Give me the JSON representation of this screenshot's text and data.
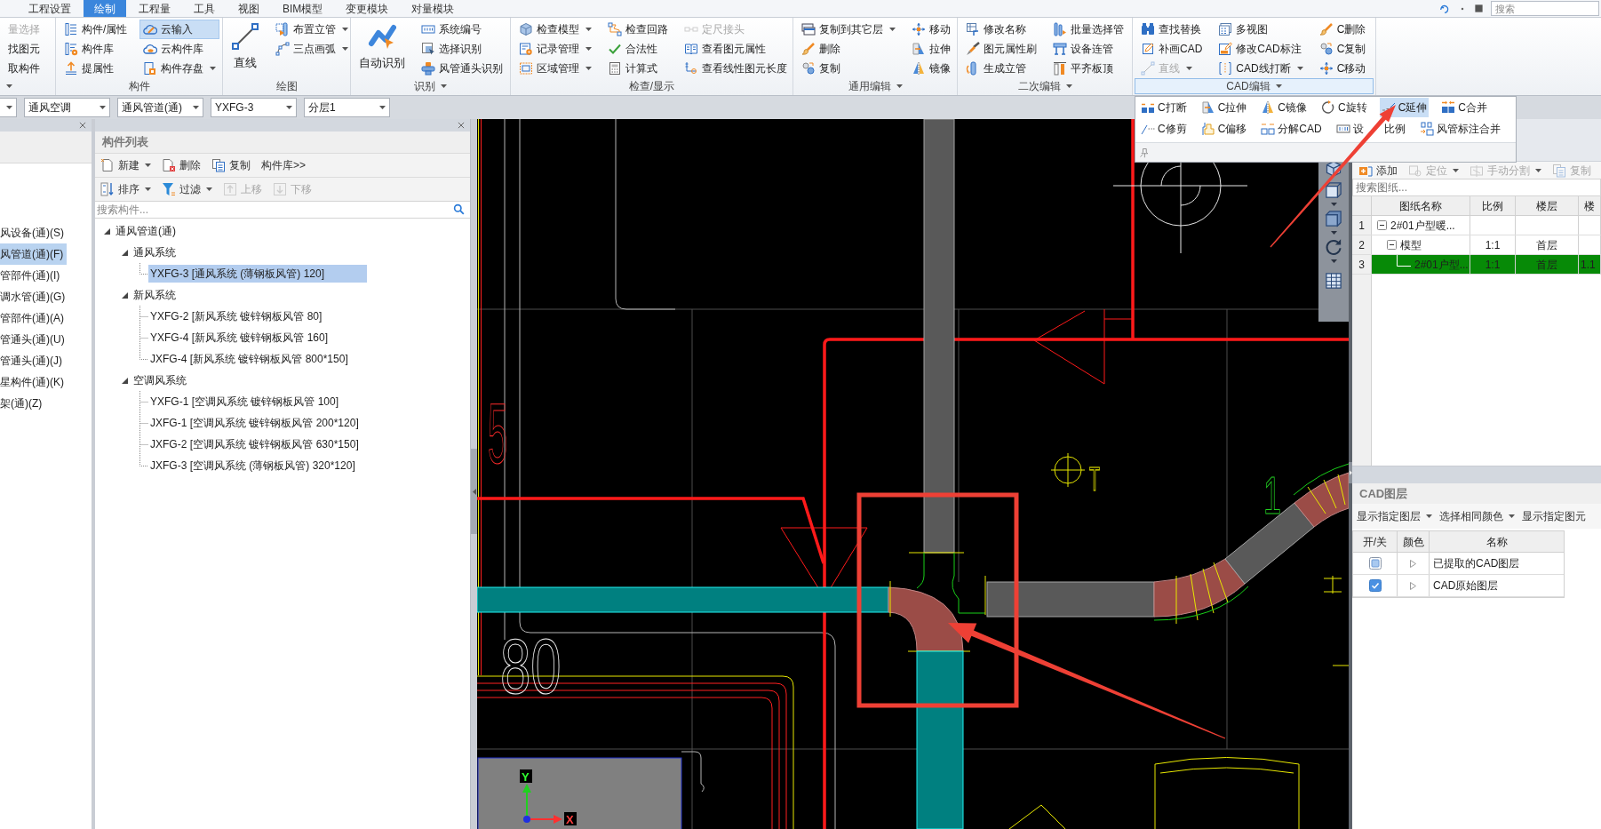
{
  "menu_tabs": [
    {
      "label": "工程设置",
      "selected": false
    },
    {
      "label": "绘制",
      "selected": true
    },
    {
      "label": "工程量",
      "selected": false
    },
    {
      "label": "工具",
      "selected": false
    },
    {
      "label": "视图",
      "selected": false
    },
    {
      "label": "BIM模型",
      "selected": false
    },
    {
      "label": "变更模块",
      "selected": false
    },
    {
      "label": "对量模块",
      "selected": false
    }
  ],
  "search": {
    "placeholder": "搜索"
  },
  "ribbon": [
    {
      "menu": true,
      "expanded": false,
      "columns": [
        {
          "kind": "small",
          "items": [
            {
              "label": "量选择",
              "disabled": true,
              "dropdown": false,
              "active": false
            },
            {
              "label": "找图元",
              "disabled": false,
              "dropdown": false,
              "active": false
            },
            {
              "label": "取构件",
              "disabled": false,
              "dropdown": false,
              "active": false
            }
          ]
        }
      ]
    },
    {
      "label": "构件",
      "menu": false,
      "expanded": false,
      "columns": [
        {
          "kind": "small",
          "items": [
            {
              "label": "构件/属性",
              "disabled": false,
              "dropdown": false,
              "active": false
            },
            {
              "label": "构件库",
              "disabled": false,
              "dropdown": false,
              "active": false
            },
            {
              "label": "提属性",
              "disabled": false,
              "dropdown": false,
              "active": false
            }
          ]
        },
        {
          "kind": "small",
          "items": [
            {
              "label": "云输入",
              "disabled": false,
              "dropdown": false,
              "active": true
            },
            {
              "label": "云构件库",
              "disabled": false,
              "dropdown": false,
              "active": false
            },
            {
              "label": "构件存盘",
              "disabled": false,
              "dropdown": true,
              "active": false
            }
          ]
        }
      ]
    },
    {
      "label": "绘图",
      "menu": false,
      "expanded": false,
      "columns": [
        {
          "kind": "large",
          "items": [
            {
              "label": "直线",
              "disabled": false,
              "dropdown": false,
              "active": false
            }
          ]
        },
        {
          "kind": "small",
          "items": [
            {
              "label": "布置立管",
              "disabled": false,
              "dropdown": true,
              "active": false
            },
            {
              "label": "三点画弧",
              "disabled": false,
              "dropdown": true,
              "active": false
            }
          ]
        }
      ]
    },
    {
      "label": "识别",
      "menu": true,
      "expanded": false,
      "columns": [
        {
          "kind": "large",
          "items": [
            {
              "label": "自动识别",
              "disabled": false,
              "dropdown": false,
              "active": false
            }
          ]
        },
        {
          "kind": "small",
          "items": [
            {
              "label": "系统编号",
              "disabled": false,
              "dropdown": false,
              "active": false
            },
            {
              "label": "选择识别",
              "disabled": false,
              "dropdown": false,
              "active": false
            },
            {
              "label": "风管通头识别",
              "disabled": false,
              "dropdown": false,
              "active": false
            }
          ]
        }
      ]
    },
    {
      "label": "检查/显示",
      "menu": false,
      "expanded": false,
      "columns": [
        {
          "kind": "small",
          "items": [
            {
              "label": "检查模型",
              "disabled": false,
              "dropdown": true,
              "active": false
            },
            {
              "label": "记录管理",
              "disabled": false,
              "dropdown": true,
              "active": false
            },
            {
              "label": "区域管理",
              "disabled": false,
              "dropdown": true,
              "active": false
            }
          ]
        },
        {
          "kind": "small",
          "items": [
            {
              "label": "检查回路",
              "disabled": false,
              "dropdown": false,
              "active": false
            },
            {
              "label": "合法性",
              "disabled": false,
              "dropdown": false,
              "active": false
            },
            {
              "label": "计算式",
              "disabled": false,
              "dropdown": false,
              "active": false
            }
          ]
        },
        {
          "kind": "small",
          "items": [
            {
              "label": "定尺接头",
              "disabled": true,
              "dropdown": false,
              "active": false
            },
            {
              "label": "查看图元属性",
              "disabled": false,
              "dropdown": false,
              "active": false
            },
            {
              "label": "查看线性图元长度",
              "disabled": false,
              "dropdown": false,
              "active": false
            }
          ]
        }
      ]
    },
    {
      "label": "通用编辑",
      "menu": true,
      "expanded": false,
      "columns": [
        {
          "kind": "small",
          "items": [
            {
              "label": "复制到其它层",
              "disabled": false,
              "dropdown": true,
              "active": false
            },
            {
              "label": "删除",
              "disabled": false,
              "dropdown": false,
              "active": false
            },
            {
              "label": "复制",
              "disabled": false,
              "dropdown": false,
              "active": false
            }
          ]
        },
        {
          "kind": "small",
          "items": [
            {
              "label": "移动",
              "disabled": false,
              "dropdown": false,
              "active": false
            },
            {
              "label": "拉伸",
              "disabled": false,
              "dropdown": false,
              "active": false
            },
            {
              "label": "镜像",
              "disabled": false,
              "dropdown": false,
              "active": false
            }
          ]
        }
      ]
    },
    {
      "label": "二次编辑",
      "menu": true,
      "expanded": false,
      "columns": [
        {
          "kind": "small",
          "items": [
            {
              "label": "修改名称",
              "disabled": false,
              "dropdown": false,
              "active": false
            },
            {
              "label": "图元属性刷",
              "disabled": false,
              "dropdown": false,
              "active": false
            },
            {
              "label": "生成立管",
              "disabled": false,
              "dropdown": false,
              "active": false
            }
          ]
        },
        {
          "kind": "small",
          "items": [
            {
              "label": "批量选择管",
              "disabled": false,
              "dropdown": false,
              "active": false
            },
            {
              "label": "设备连管",
              "disabled": false,
              "dropdown": false,
              "active": false
            },
            {
              "label": "平齐板顶",
              "disabled": false,
              "dropdown": false,
              "active": false
            }
          ]
        }
      ]
    },
    {
      "label": "CAD编辑",
      "menu": true,
      "expanded": true,
      "columns": [
        {
          "kind": "small",
          "items": [
            {
              "label": "查找替换",
              "disabled": false,
              "dropdown": false,
              "active": false
            },
            {
              "label": "补画CAD",
              "disabled": false,
              "dropdown": false,
              "active": false
            },
            {
              "label": "直线",
              "disabled": true,
              "dropdown": true,
              "active": false
            }
          ]
        },
        {
          "kind": "small",
          "items": [
            {
              "label": "多视图",
              "disabled": false,
              "dropdown": false,
              "active": false
            },
            {
              "label": "修改CAD标注",
              "disabled": false,
              "dropdown": false,
              "active": false
            },
            {
              "label": "CAD线打断",
              "disabled": false,
              "dropdown": true,
              "active": false
            }
          ]
        },
        {
          "kind": "small",
          "items": [
            {
              "label": "C删除",
              "disabled": false,
              "dropdown": false,
              "active": false
            },
            {
              "label": "C复制",
              "disabled": false,
              "dropdown": false,
              "active": false
            },
            {
              "label": "C移动",
              "disabled": false,
              "dropdown": false,
              "active": false
            }
          ]
        }
      ]
    }
  ],
  "cad_edit_menu": {
    "items": [
      {
        "label": "C打断",
        "selected": false
      },
      {
        "label": "C拉伸",
        "selected": false
      },
      {
        "label": "C镜像",
        "selected": false
      },
      {
        "label": "C旋转",
        "selected": false
      },
      {
        "label": "C延伸",
        "selected": true
      },
      {
        "label": "C合并",
        "selected": false
      },
      {
        "label": "C修剪",
        "selected": false
      },
      {
        "label": "C偏移",
        "selected": false
      },
      {
        "label": "分解CAD",
        "selected": false
      },
      {
        "label": "设 比例",
        "selected": false
      },
      {
        "label": "风管标注合并",
        "selected": false
      }
    ]
  },
  "toolbar": {
    "combos": [
      {
        "value": "通风空调"
      },
      {
        "value": "通风管道(通)"
      },
      {
        "value": "YXFG-3"
      },
      {
        "value": "分层1"
      }
    ]
  },
  "category_panel": {
    "items": [
      {
        "label": "风设备(通)(S)",
        "selected": false
      },
      {
        "label": "风管道(通)(F)",
        "selected": true
      },
      {
        "label": "管部件(通)(I)",
        "selected": false
      },
      {
        "label": "调水管(通)(G)",
        "selected": false
      },
      {
        "label": "管部件(通)(A)",
        "selected": false
      },
      {
        "label": "管通头(通)(U)",
        "selected": false
      },
      {
        "label": "管通头(通)(J)",
        "selected": false
      },
      {
        "label": "星构件(通)(K)",
        "selected": false
      },
      {
        "label": "架(通)(Z)",
        "selected": false
      }
    ]
  },
  "component_list": {
    "title": "构件列表",
    "toolbar": [
      {
        "label": "新建",
        "dropdown": true,
        "disabled": false
      },
      {
        "label": "删除",
        "dropdown": false,
        "disabled": false
      },
      {
        "label": "复制",
        "dropdown": false,
        "disabled": false
      },
      {
        "label": "构件库>>",
        "dropdown": false,
        "disabled": false
      }
    ],
    "toolbar_2": [
      {
        "label": "排序",
        "dropdown": true,
        "disabled": false
      },
      {
        "label": "过滤",
        "dropdown": true,
        "disabled": false
      },
      {
        "label": "上移",
        "dropdown": false,
        "disabled": true
      },
      {
        "label": "下移",
        "dropdown": false,
        "disabled": true
      }
    ],
    "search": {
      "placeholder": "搜索构件..."
    },
    "tree": [
      {
        "label": "通风管道(通)",
        "expanded": true,
        "selected": false,
        "children": [
          {
            "label": "通风系统",
            "expanded": true,
            "selected": false,
            "children": [
              {
                "label": "YXFG-3 [通风系统 (薄钢板风管) 120]",
                "selected": true
              }
            ]
          },
          {
            "label": "新风系统",
            "expanded": true,
            "selected": false,
            "children": [
              {
                "label": "YXFG-2 [新风系统 镀锌钢板风管 80]",
                "selected": false
              },
              {
                "label": "YXFG-4 [新风系统 镀锌钢板风管 160]",
                "selected": false
              },
              {
                "label": "JXFG-4 [新风系统 镀锌钢板风管 800*150]",
                "selected": false
              }
            ]
          },
          {
            "label": "空调风系统",
            "expanded": true,
            "selected": false,
            "children": [
              {
                "label": "YXFG-1 [空调风系统 镀锌钢板风管 100]",
                "selected": false
              },
              {
                "label": "JXFG-1 [空调风系统 镀锌钢板风管 200*120]",
                "selected": false
              },
              {
                "label": "JXFG-2 [空调风系统 镀锌钢板风管 630*150]",
                "selected": false
              },
              {
                "label": "JXFG-3 [空调风系统 (薄钢板风管) 320*120]",
                "selected": false
              }
            ]
          }
        ]
      }
    ]
  },
  "canvas": {
    "labels": [
      {
        "text": "5"
      },
      {
        "text": "80"
      },
      {
        "text": "T"
      },
      {
        "text": "1"
      }
    ],
    "axis": {
      "x": "X",
      "y": "Y"
    }
  },
  "drawing_panel": {
    "toolbar": [
      {
        "label": "添加",
        "dropdown": false,
        "disabled": false
      },
      {
        "label": "定位",
        "dropdown": true,
        "disabled": true
      },
      {
        "label": "手动分割",
        "dropdown": true,
        "disabled": true
      },
      {
        "label": "复制",
        "dropdown": false,
        "disabled": true
      }
    ],
    "search": {
      "placeholder": "搜索图纸..."
    },
    "columns": [
      "图纸名称",
      "比例",
      "楼层",
      "楼"
    ],
    "rows": [
      {
        "number": "1",
        "name": "2#01户型暖...",
        "expanded": true,
        "selected": false,
        "children": [
          {
            "number": "2",
            "name": "模型",
            "scale": "1:1",
            "floor": "首层",
            "expanded": true,
            "selected": false,
            "children": [
              {
                "number": "3",
                "name": "2#01户型...",
                "scale": "1:1",
                "floor": "首层",
                "column_4": "1.1",
                "selected": true
              }
            ]
          }
        ]
      }
    ]
  },
  "cad_layers": {
    "title": "CAD图层",
    "toolbar": [
      {
        "label": "显示指定图层",
        "dropdown": true
      },
      {
        "label": "选择相同颜色",
        "dropdown": true
      },
      {
        "label": "显示指定图元",
        "dropdown": false
      }
    ],
    "columns": [
      "开/关",
      "颜色",
      "名称"
    ],
    "rows": [
      {
        "name": "已提取的CAD图层",
        "checked": false
      },
      {
        "name": "CAD原始图层",
        "checked": true
      }
    ]
  }
}
